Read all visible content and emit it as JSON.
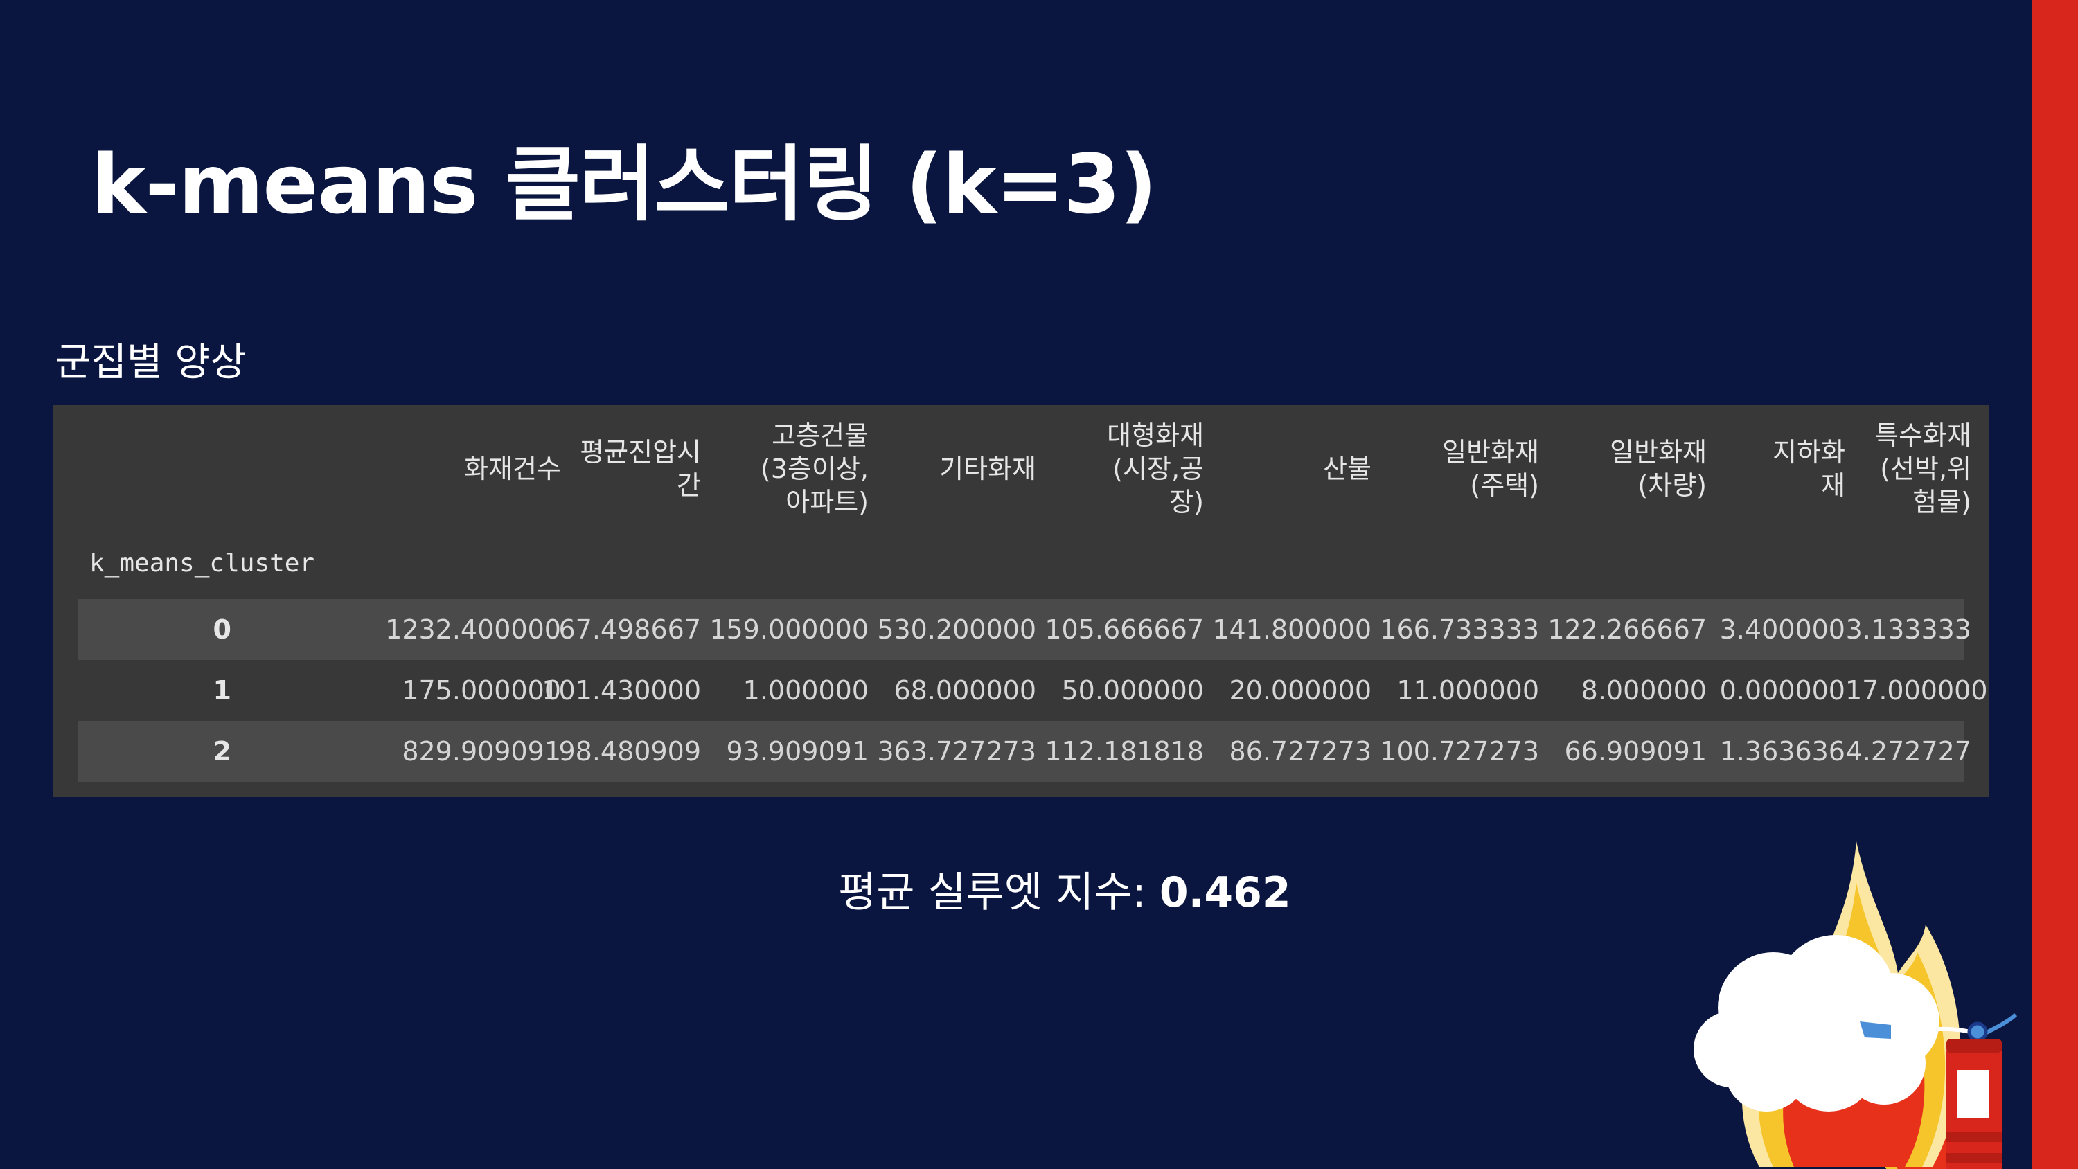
{
  "title": "k-means 클러스터링 (k=3)",
  "subtitle": "군집별 양상",
  "table": {
    "index_name": "k_means_cluster",
    "columns": [
      "화재건수",
      "평균진압시\n간",
      "고층건물\n(3층이상,\n아파트)",
      "기타화재",
      "대형화재\n(시장,공\n장)",
      "산불",
      "일반화재\n(주택)",
      "일반화재\n(차량)",
      "지하화\n재",
      "특수화재\n(선박,위\n험물)"
    ],
    "rows": [
      {
        "index": "0",
        "values": [
          "1232.400000",
          "67.498667",
          "159.000000",
          "530.200000",
          "105.666667",
          "141.800000",
          "166.733333",
          "122.266667",
          "3.400000",
          "3.133333"
        ]
      },
      {
        "index": "1",
        "values": [
          "175.000000",
          "101.430000",
          "1.000000",
          "68.000000",
          "50.000000",
          "20.000000",
          "11.000000",
          "8.000000",
          "0.000000",
          "17.000000"
        ]
      },
      {
        "index": "2",
        "values": [
          "829.909091",
          "98.480909",
          "93.909091",
          "363.727273",
          "112.181818",
          "86.727273",
          "100.727273",
          "66.909091",
          "1.363636",
          "4.272727"
        ]
      }
    ]
  },
  "silhouette": {
    "label": "평균 실루엣 지수:",
    "value": "0.462"
  },
  "colors": {
    "background": "#0a163f",
    "accent_bar": "#d9261c",
    "table_bg": "#383838",
    "row_alt": "#4a4a4a"
  },
  "decoration": {
    "icon": "fire-extinguisher-flames-icon"
  }
}
